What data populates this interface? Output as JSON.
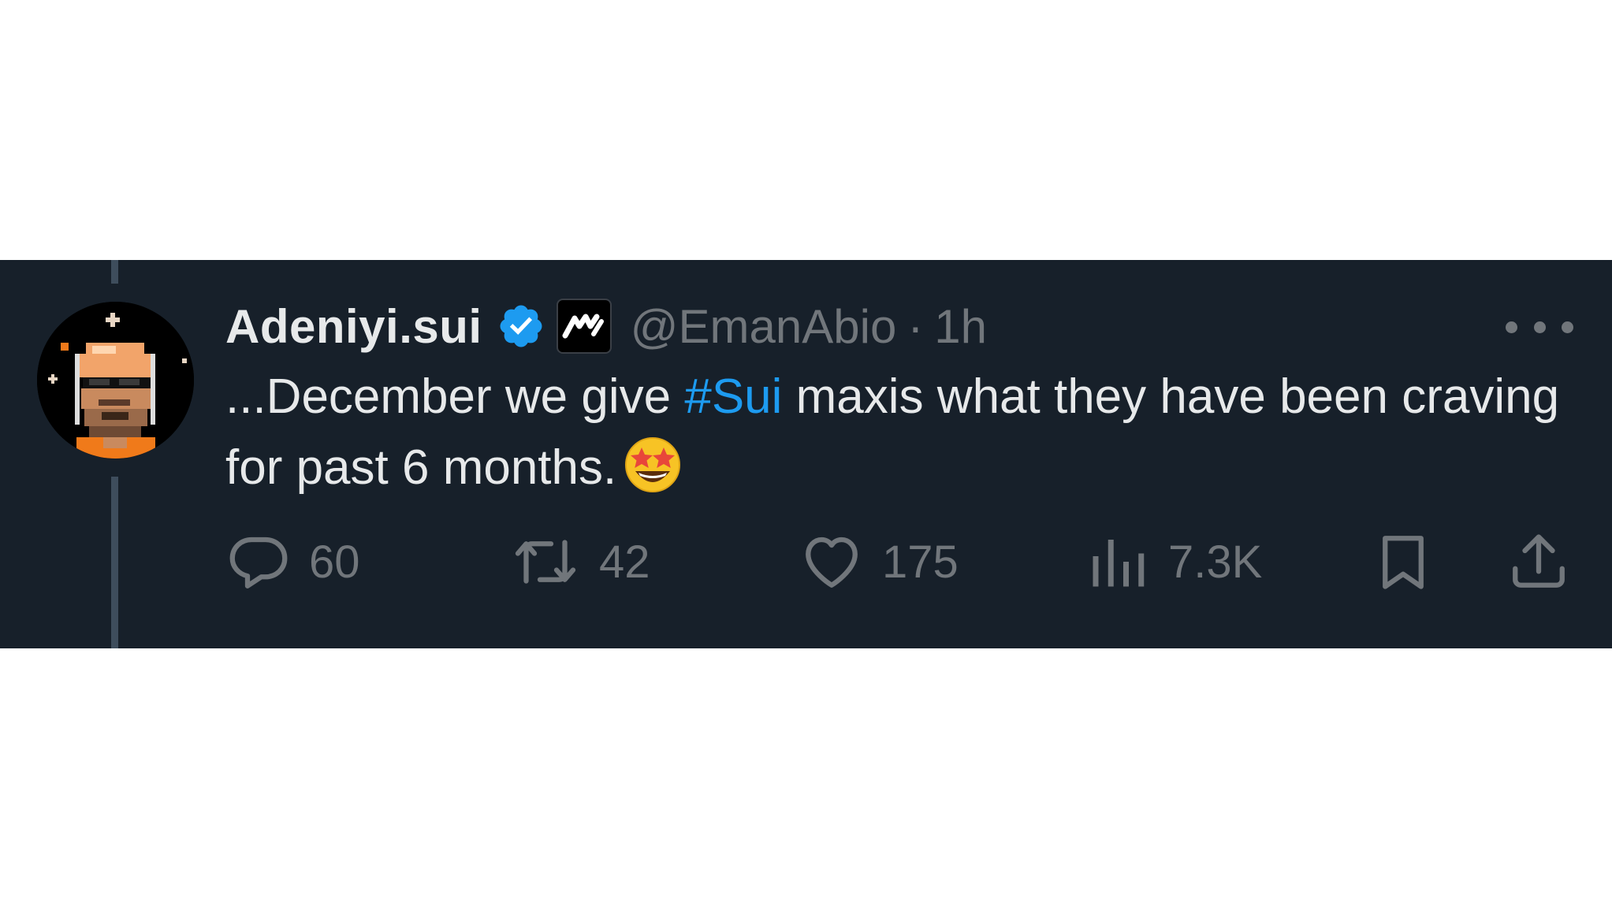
{
  "tweet": {
    "display_name": "Adeniyi.sui",
    "handle": "@EmanAbio",
    "separator": "·",
    "time": "1h",
    "text_before": "...December we give ",
    "hashtag": "#Sui",
    "text_after": " maxis what they have been craving for past 6 months.",
    "emoji": "star-struck-emoji"
  },
  "actions": {
    "replies": "60",
    "retweets": "42",
    "likes": "175",
    "views": "7.3K"
  },
  "icons": {
    "verified": "verified-badge-icon",
    "affiliate": "affiliate-logo-icon",
    "more": "more-options-icon",
    "reply": "reply-icon",
    "retweet": "retweet-icon",
    "like": "heart-icon",
    "views": "views-chart-icon",
    "bookmark": "bookmark-icon",
    "share": "share-icon"
  },
  "colors": {
    "background": "#17202a",
    "text": "#e7e9ea",
    "muted": "#71767b",
    "accent": "#1d9bf0"
  }
}
